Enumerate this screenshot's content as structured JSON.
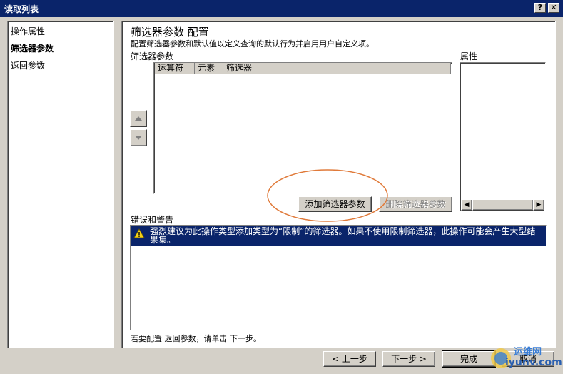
{
  "window": {
    "title": "读取列表",
    "help_label": "?",
    "close_label": "✕"
  },
  "nav": {
    "items": [
      "操作属性",
      "筛选器参数",
      "返回参数"
    ],
    "selected_index": 1
  },
  "main": {
    "heading": "筛选器参数 配置",
    "description": "配置筛选器参数和默认值以定义查询的默认行为并启用用户自定义项。",
    "filters_label": "筛选器参数",
    "columns": [
      "运算符",
      "元素",
      "筛选器"
    ],
    "properties_label": "属性",
    "move_up_icon": "triangle-up-icon",
    "move_down_icon": "triangle-down-icon",
    "add_button": "添加筛选器参数",
    "delete_button": "删除筛选器参数",
    "errors_label": "错误和警告",
    "warning_message": "强烈建议为此操作类型添加类型为“限制”的筛选器。如果不使用限制筛选器，此操作可能会产生大型结果集。",
    "footer_hint": "若要配置 返回参数，请单击 下一步。"
  },
  "buttons": {
    "back": "< 上一步",
    "next": "下一步 >",
    "finish": "完成",
    "cancel": "取消"
  },
  "watermark": {
    "text_top": "运维网",
    "text_bottom": "iyunv.com"
  },
  "colors": {
    "title_bar": "#0a246a",
    "selection": "#0a246a",
    "dialog_bg": "#d4d0c8",
    "annotation_circle": "#e07a3a"
  }
}
